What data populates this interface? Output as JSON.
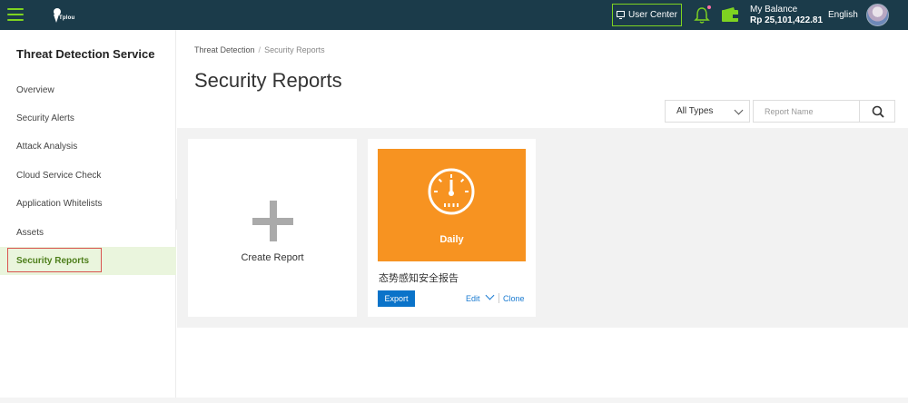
{
  "topbar": {
    "logo_text": "Tplou",
    "user_center": "User Center",
    "balance_label": "My Balance",
    "balance_amount": "Rp 25,101,422.81",
    "language": "English"
  },
  "sidebar": {
    "title": "Threat Detection Service",
    "items": [
      {
        "label": "Overview"
      },
      {
        "label": "Security Alerts"
      },
      {
        "label": "Attack Analysis"
      },
      {
        "label": "Cloud Service Check"
      },
      {
        "label": "Application Whitelists"
      },
      {
        "label": "Assets"
      },
      {
        "label": "Security Reports"
      }
    ]
  },
  "breadcrumb": {
    "root": "Threat Detection",
    "separator": "/",
    "current": "Security Reports"
  },
  "page_title": "Security Reports",
  "filters": {
    "type_select": "All Types",
    "search_placeholder": "Report Name"
  },
  "create_card": {
    "label": "Create Report"
  },
  "reports": [
    {
      "banner_label": "Daily",
      "name": "态势感知安全报告",
      "export_label": "Export",
      "edit_label": "Edit",
      "clone_label": "Clone"
    }
  ],
  "colors": {
    "topbar": "#1b3b4a",
    "accent_green": "#7ed321",
    "banner_orange": "#f79321",
    "primary_blue": "#0a73c9"
  }
}
